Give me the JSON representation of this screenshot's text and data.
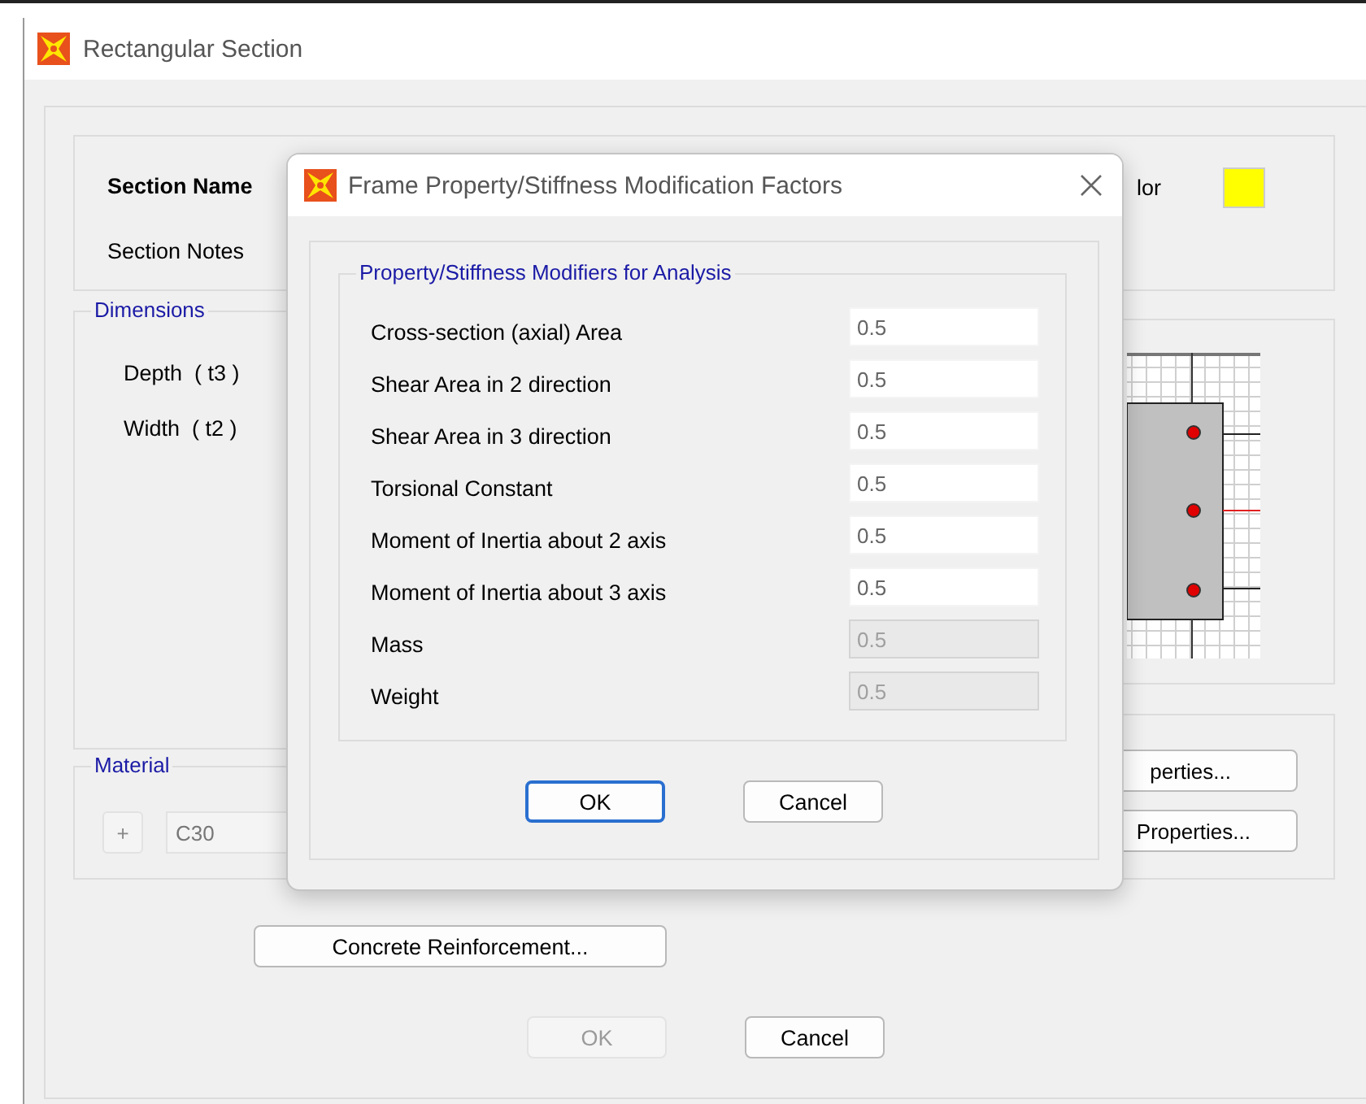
{
  "window": {
    "title": "Rectangular Section"
  },
  "section": {
    "name_label": "Section Name",
    "notes_label": "Section Notes",
    "color_label": "lor",
    "color": "#ffff00"
  },
  "dimensions": {
    "title": "Dimensions",
    "labels": [
      "Depth  ( t3 )",
      "Width  ( t2 )"
    ]
  },
  "material": {
    "title": "Material",
    "add_button": "+",
    "value": "C30"
  },
  "side_buttons": [
    "perties...",
    "Properties..."
  ],
  "reinforcement_button": "Concrete Reinforcement...",
  "buttons": [
    {
      "label": "OK",
      "disabled": true
    },
    {
      "label": "Cancel",
      "disabled": false
    }
  ],
  "dialog": {
    "title": "Frame Property/Stiffness Modification Factors",
    "group_title": "Property/Stiffness Modifiers for Analysis",
    "modifiers": [
      {
        "label": "Cross-section (axial) Area",
        "value": "0.5",
        "disabled": false
      },
      {
        "label": "Shear Area in 2 direction",
        "value": "0.5",
        "disabled": false
      },
      {
        "label": "Shear Area in 3 direction",
        "value": "0.5",
        "disabled": false
      },
      {
        "label": "Torsional Constant",
        "value": "0.5",
        "disabled": false
      },
      {
        "label": "Moment of Inertia about 2 axis",
        "value": "0.5",
        "disabled": false
      },
      {
        "label": "Moment of Inertia about 3 axis",
        "value": "0.5",
        "disabled": false
      },
      {
        "label": "Mass",
        "value": "0.5",
        "disabled": true
      },
      {
        "label": "Weight",
        "value": "0.5",
        "disabled": true
      }
    ],
    "buttons": [
      {
        "label": "OK",
        "focused": true
      },
      {
        "label": "Cancel",
        "focused": false
      }
    ]
  }
}
